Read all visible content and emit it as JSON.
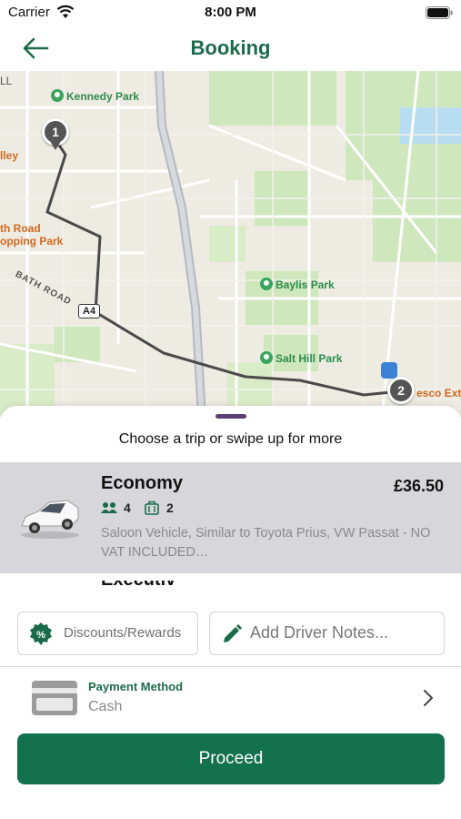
{
  "status_bar": {
    "carrier": "Carrier",
    "time": "8:00 PM"
  },
  "nav": {
    "title": "Booking"
  },
  "map": {
    "labels": {
      "kennedy_park": "Kennedy Park",
      "left_edge_1": "LL",
      "left_edge_2": "lley",
      "bath_road_shopping_1": "th Road",
      "bath_road_shopping_2": "opping Park",
      "bath_road": "BATH ROAD",
      "a4": "A4",
      "baylis_park": "Baylis Park",
      "salt_hill_park": "Salt Hill Park",
      "tesco": "esco Ext"
    },
    "markers": {
      "start": "1",
      "end": "2"
    }
  },
  "sheet": {
    "hint": "Choose a trip or swipe up for more",
    "trip": {
      "name": "Economy",
      "price": "£36.50",
      "passengers": "4",
      "luggage": "2",
      "description": "Saloon Vehicle, Similar to Toyota Prius, VW Passat - NO VAT INCLUDED…"
    },
    "next_trip_peek": "Executive",
    "discounts_label": "Discounts/Rewards",
    "notes_placeholder": "Add Driver Notes...",
    "payment": {
      "label": "Payment Method",
      "value": "Cash"
    },
    "proceed_label": "Proceed"
  },
  "colors": {
    "brand_green": "#14714d",
    "title_green": "#1b6b4a",
    "handle": "#5a3f77",
    "selected_row": "#d7d7db"
  }
}
